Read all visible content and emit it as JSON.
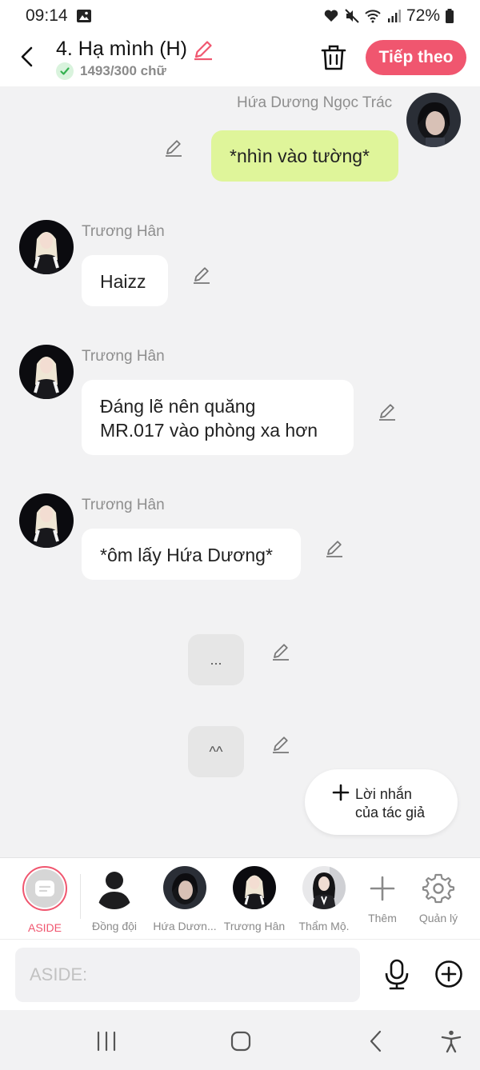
{
  "status_bar": {
    "time": "09:14",
    "battery": "72%"
  },
  "header": {
    "title": "4. Hạ mình (H)",
    "word_count": "1493/300 chữ",
    "next_label": "Tiếp theo"
  },
  "messages": [
    {
      "speaker": "Hứa Dương Ngọc Trác",
      "text": "*nhìn vào tường*"
    },
    {
      "speaker": "Trương Hân",
      "text": "Haizz"
    },
    {
      "speaker": "Trương Hân",
      "lines": [
        "Đáng lẽ nên quăng",
        "MR.017 vào phòng xa hơn"
      ]
    },
    {
      "speaker": "Trương Hân",
      "text": "*ôm lấy Hứa Dương*"
    },
    {
      "text": "..."
    },
    {
      "text": "^^"
    }
  ],
  "author_note": {
    "line1": "Lời nhắn",
    "line2": "của tác giả"
  },
  "characters": [
    {
      "label": "ASIDE"
    },
    {
      "label": "Đồng đội"
    },
    {
      "label": "Hứa Dươn..."
    },
    {
      "label": "Trương Hân"
    },
    {
      "label": "Thẩm Mộ."
    },
    {
      "label": "Thêm"
    },
    {
      "label": "Quản lý"
    }
  ],
  "input": {
    "placeholder": "ASIDE:"
  },
  "colors": {
    "accent": "#f0566f",
    "user_bubble": "#dff59a",
    "background": "#f2f2f3"
  }
}
